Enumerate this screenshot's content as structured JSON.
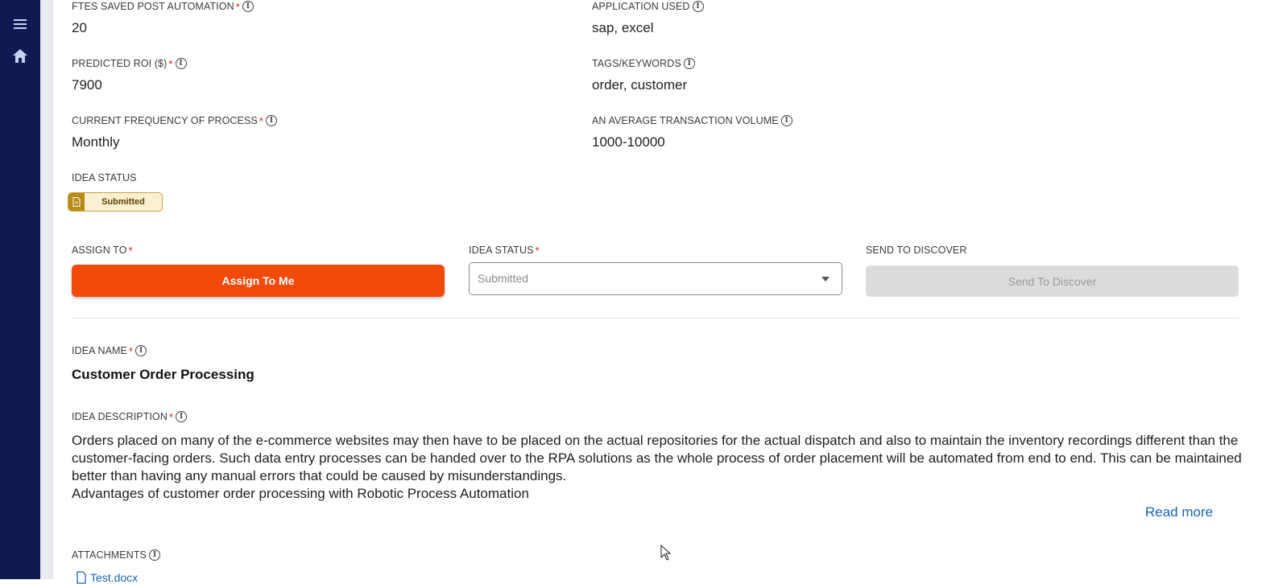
{
  "sidebar": {
    "menu_icon": "hamburger-menu-icon",
    "home_icon": "home-icon",
    "background": "#101a52"
  },
  "fields": {
    "ftes_saved": {
      "label": "FTES SAVED POST AUTOMATION",
      "value": "20"
    },
    "application_used": {
      "label": "APPLICATION USED",
      "value": "sap, excel"
    },
    "predicted_roi": {
      "label": "PREDICTED ROI ($)",
      "value": "7900"
    },
    "tags_keywords": {
      "label": "TAGS/KEYWORDS",
      "value": "order, customer"
    },
    "current_frequency": {
      "label": "CURRENT FREQUENCY OF PROCESS",
      "value": "Monthly"
    },
    "avg_transaction_volume": {
      "label": "AN AVERAGE TRANSACTION VOLUME",
      "value": "1000-10000"
    }
  },
  "idea_status_display": {
    "label": "IDEA STATUS",
    "badge": "Submitted",
    "badge_color": "#fbf1d2"
  },
  "actions": {
    "assign_to_label": "ASSIGN TO",
    "assign_button": "Assign To Me",
    "assign_color": "#f24a0b",
    "idea_status_label": "IDEA STATUS",
    "idea_status_value": "Submitted",
    "send_to_discover_label": "SEND TO DISCOVER",
    "send_to_discover_button": "Send To Discover"
  },
  "idea": {
    "name_label": "IDEA NAME",
    "name": "Customer Order Processing",
    "description_label": "IDEA DESCRIPTION",
    "description_1": "Orders placed on many of the e-commerce websites may then have to be placed on the actual repositories for the actual dispatch and also to maintain the inventory recordings different than the customer-facing orders. Such data entry processes can be handed over to the RPA solutions as the whole process of order placement will be automated from end to end. This can be maintained better than having any manual errors that could be caused by misunderstandings.",
    "description_2": "Advantages of customer order processing with Robotic Process Automation",
    "read_more": "Read more",
    "link_color": "#1766b5"
  },
  "attachments": {
    "label": "ATTACHMENTS",
    "files": [
      "Test.docx"
    ]
  },
  "info_glyph": "i",
  "required_glyph": "*"
}
